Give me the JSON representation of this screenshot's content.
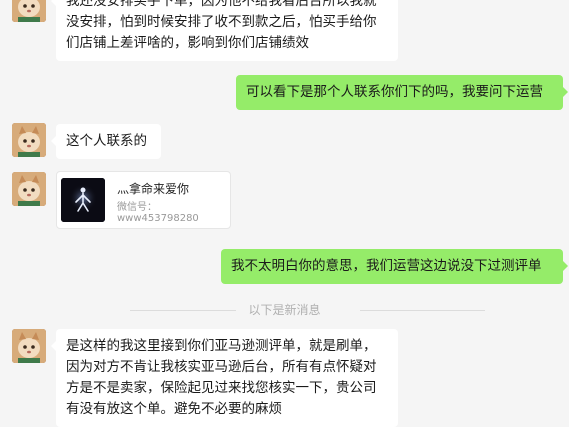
{
  "messages": {
    "m1": "我还没安排买手下单，因为他不给我看后台所以我就没安排，怕到时候安排了收不到款之后，怕买手给你们店铺上差评啥的，影响到你们店铺绩效",
    "m2": "可以看下是那个人联系你们下的吗，我要问下运营",
    "m3": "这个人联系的",
    "m5": "我不太明白你的意思，我们运营这边说没下过测评单",
    "m6": "是这样的我这里接到你们亚马逊测评单，就是刷单，因为对方不肯让我核实亚马逊后台，所有有点怀疑对方是不是卖家，保险起见过来找您核实一下，贵公司有没有放这个单。避免不必要的麻烦"
  },
  "contact_card": {
    "name": "灬拿命来爱你",
    "wechat_id": "微信号：www453798280"
  },
  "divider_text": "以下是新消息",
  "colors": {
    "background": "#f5f5f5",
    "incoming_bubble": "#ffffff",
    "outgoing_bubble": "#95ec69"
  },
  "icons": {
    "sender_avatar": "cat-avatar-icon",
    "card_avatar": "dark-figure-avatar-icon"
  }
}
